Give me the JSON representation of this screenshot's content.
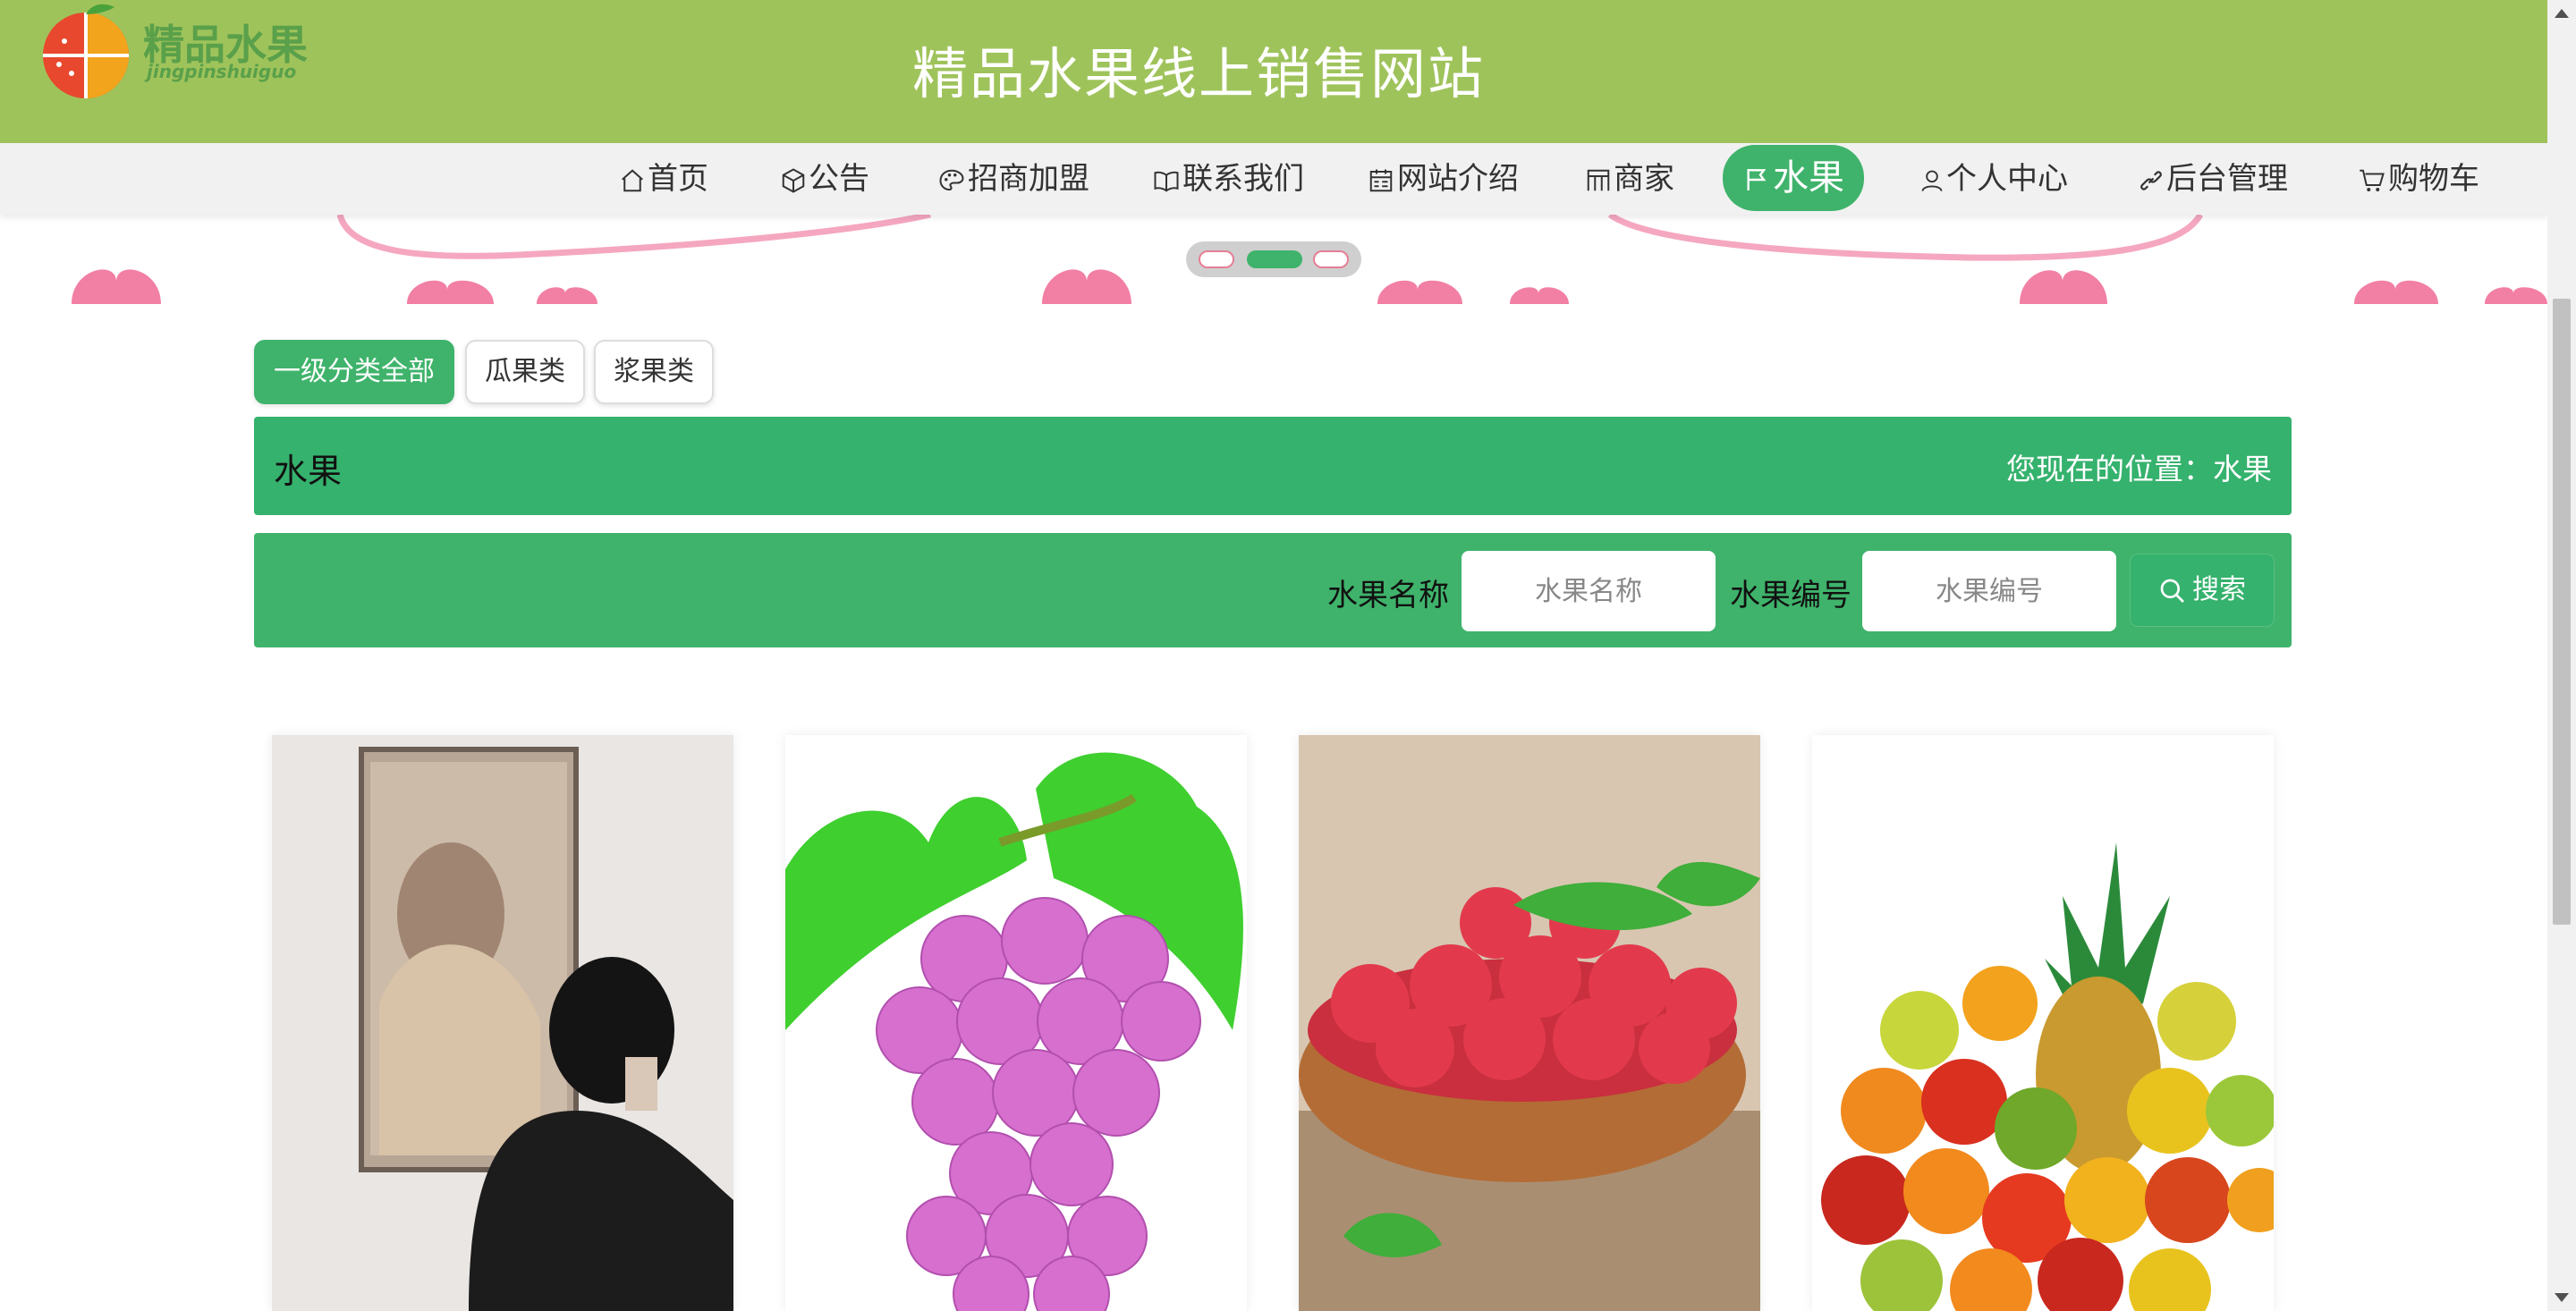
{
  "header": {
    "logo_text": "精品水果",
    "logo_subtext": "jingpinshuiguo",
    "site_title": "精品水果线上销售网站"
  },
  "nav": {
    "items": [
      {
        "label": "首页",
        "icon": "home-icon"
      },
      {
        "label": "公告",
        "icon": "box-icon"
      },
      {
        "label": "招商加盟",
        "icon": "palette-icon"
      },
      {
        "label": "联系我们",
        "icon": "book-icon"
      },
      {
        "label": "网站介绍",
        "icon": "calendar-icon"
      },
      {
        "label": "商家",
        "icon": "grid-icon"
      },
      {
        "label": "水果",
        "icon": "flag-icon",
        "active": true
      },
      {
        "label": "个人中心",
        "icon": "user-icon"
      },
      {
        "label": "后台管理",
        "icon": "link-icon"
      },
      {
        "label": "购物车",
        "icon": "cart-icon"
      }
    ]
  },
  "carousel": {
    "slide_count": 3,
    "active_index": 1
  },
  "categories": [
    "一级分类全部",
    "瓜果类",
    "浆果类"
  ],
  "page": {
    "title": "水果",
    "breadcrumb_prefix": "您现在的位置：",
    "breadcrumb_current": "水果",
    "breadcrumb": "您现在的位置：水果"
  },
  "search": {
    "name_label": "水果名称",
    "name_placeholder": "水果名称",
    "code_label": "水果编号",
    "code_placeholder": "水果编号",
    "button_label": "搜索"
  },
  "products": [
    {
      "image": "person-viewing-painting-photo"
    },
    {
      "image": "purple-grapes-photo"
    },
    {
      "image": "raspberries-in-bowl-photo"
    },
    {
      "image": "pineapple-mixed-fruit-photo"
    }
  ],
  "colors": {
    "header_bg": "#9fc35b",
    "accent_green": "#3fb36b",
    "title_bar_green": "#35b26d",
    "nav_bg": "#f1f1f1",
    "heart_pink": "#f27fa4"
  }
}
